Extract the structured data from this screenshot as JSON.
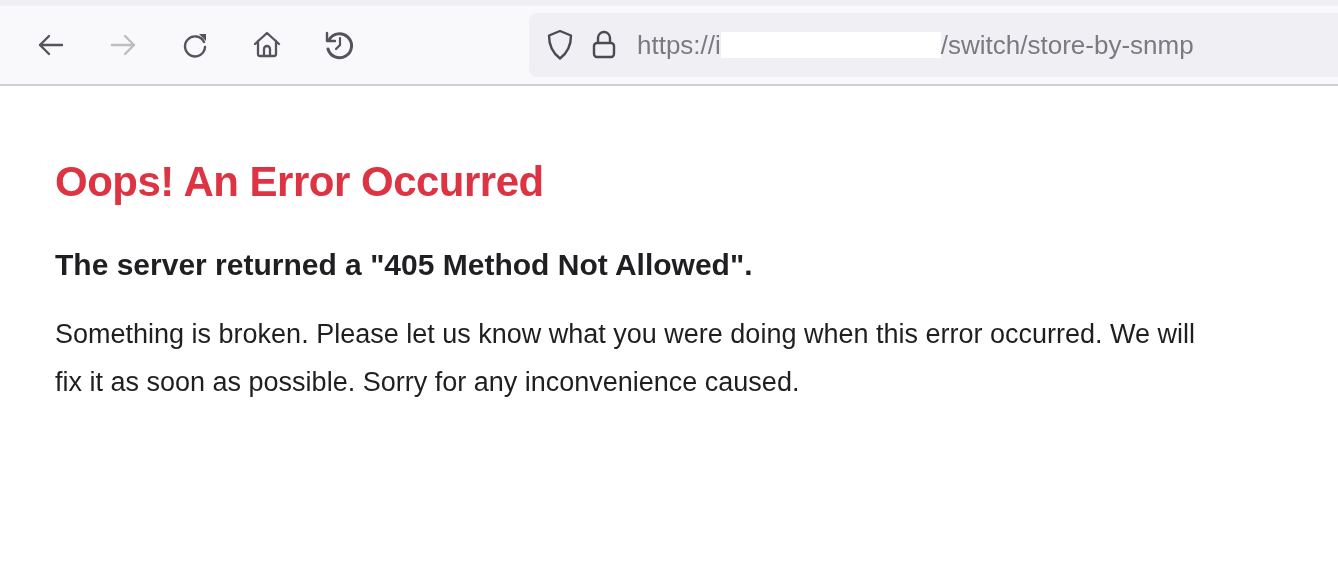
{
  "toolbar": {
    "buttons": [
      {
        "kind": "back",
        "disabled": false
      },
      {
        "kind": "forward",
        "disabled": true
      },
      {
        "kind": "reload",
        "disabled": false
      },
      {
        "kind": "home",
        "disabled": false
      },
      {
        "kind": "history",
        "disabled": false
      }
    ],
    "address_bar": {
      "url_start": "https://i",
      "url_end": "/switch/store-by-snmp"
    }
  },
  "page": {
    "title": "Oops! An Error Occurred",
    "subtitle": "The server returned a \"405 Method Not Allowed\".",
    "message": "Something is broken. Please let us know what you were doing when this error occurred. We will fix it as soon as possible. Sorry for any inconvenience caused."
  }
}
